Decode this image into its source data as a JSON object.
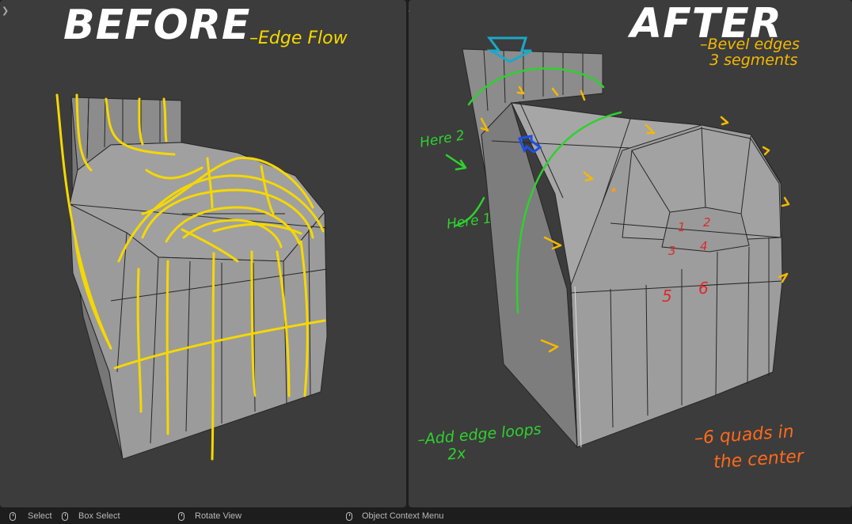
{
  "left_panel": {
    "title": "BEFORE",
    "note_edge_flow": "Edge Flow"
  },
  "right_panel": {
    "title": "AFTER",
    "note_bevel_line1": "Bevel edges",
    "note_bevel_line2": "3 segments",
    "note_here2": "Here 2",
    "note_here1": "Here 1",
    "note_loops_line1": "Add edge loops",
    "note_loops_line2": "2x",
    "note_quads_line1": "6 quads in",
    "note_quads_line2": "the center",
    "quad_numbers": [
      "1",
      "2",
      "3",
      "4",
      "5",
      "6"
    ]
  },
  "statusbar": {
    "select": "Select",
    "box_select": "Box Select",
    "rotate_view": "Rotate View",
    "context_menu": "Object Context Menu"
  },
  "colors": {
    "background": "#3c3c3c",
    "mesh_fill": "#9a9a9a",
    "annotation_yellow": "#f5d800",
    "annotation_green": "#2ed12e",
    "annotation_orange": "#ff6a1a",
    "quad_numbers": "#dd2a2a"
  },
  "icons": [
    "mouse-left-icon",
    "mouse-drag-icon",
    "mouse-middle-icon",
    "mouse-right-icon",
    "expand-arrow-icon"
  ]
}
